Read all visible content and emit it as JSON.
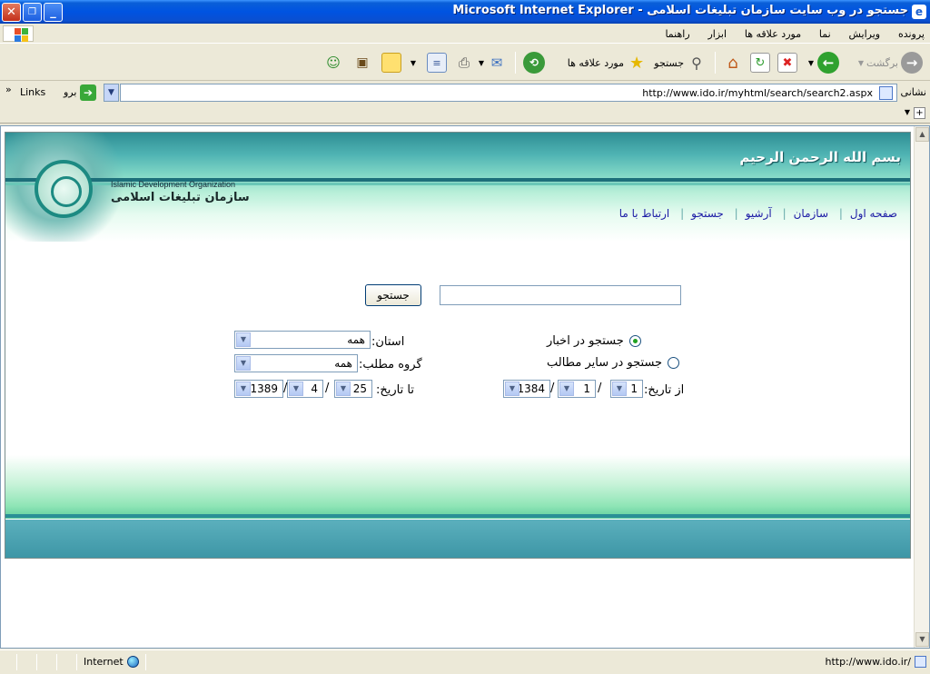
{
  "window": {
    "title": "جستجو در وب سایت سازمان تبلیغات اسلامی - Microsoft Internet Explorer",
    "buttons": {
      "minimize": "_",
      "restore": "❐",
      "close": "✕"
    }
  },
  "menu": {
    "items": [
      "پرونده",
      "ویرایش",
      "نما",
      "مورد علاقه ها",
      "ابزار",
      "راهنما"
    ]
  },
  "toolbar": {
    "back_label": "برگشت",
    "search_label": "جستجو",
    "favorites_label": "مورد علاقه ها"
  },
  "address": {
    "label": "نشانی",
    "url": "http://www.ido.ir/myhtml/search/search2.aspx",
    "go_label": "برو",
    "links_label": "Links",
    "chevron": "»"
  },
  "site": {
    "bismillah": "بسم الله الرحمن الرحیم",
    "org_en": "Islamic Development Organization",
    "org_fa": "سازمان تبلیغات اسلامی",
    "nav": [
      "صفحه اول",
      "سازمان",
      "آرشیو",
      "جستجو",
      "ارتباط با ما"
    ]
  },
  "form": {
    "search_value": "",
    "search_button": "جستجو",
    "radio_news": "جستجو در اخبار",
    "radio_other": "جستجو در سایر مطالب",
    "radio_news_checked": true,
    "province_label": "استان:",
    "province_value": "همه",
    "group_label": "گروه مطلب:",
    "group_value": "همه",
    "from_label": "از تاریخ:",
    "from_day": "1",
    "from_month": "1",
    "from_year": "1384",
    "to_label": "تا تاریخ:",
    "to_day": "25",
    "to_month": "4",
    "to_year": "1389"
  },
  "status": {
    "url": "http://www.ido.ir/",
    "zone": "Internet"
  }
}
